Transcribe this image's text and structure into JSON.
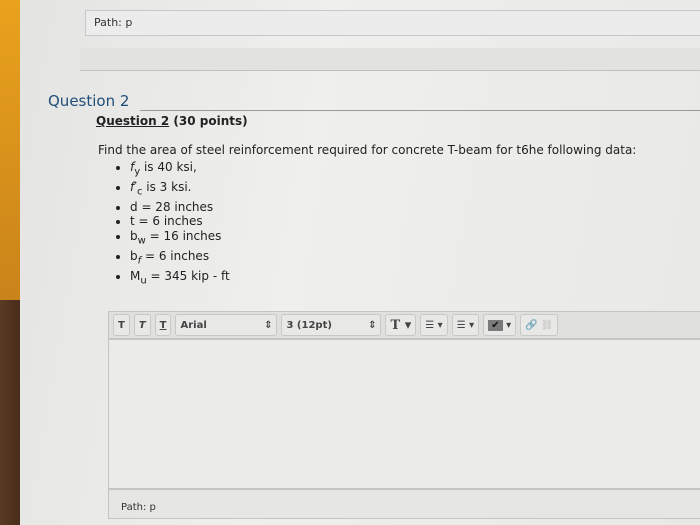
{
  "top_path": "Path: p",
  "question": {
    "heading": "Question 2",
    "sub_link": "Question 2",
    "points": "(30 points)",
    "prompt": "Find the area of steel reinforcement required for concrete T-beam for t6he following data:",
    "items": [
      {
        "sym": "f",
        "sub": "y",
        "text": " is 40 ksi,"
      },
      {
        "sym": "f′",
        "sub": "c",
        "text": " is 3 ksi."
      },
      {
        "sym": "d",
        "sub": "",
        "text": " = 28 inches"
      },
      {
        "sym": "t",
        "sub": "",
        "text": " = 6 inches"
      },
      {
        "sym": "b",
        "sub": "w",
        "text": " = 16 inches"
      },
      {
        "sym": "b",
        "sub": "f",
        "text": " = 6 inches"
      },
      {
        "sym": "M",
        "sub": "u",
        "text": " = 345 kip - ft"
      }
    ]
  },
  "toolbar": {
    "bold": "T",
    "italic": "T",
    "underline": "T",
    "font": "Arial",
    "size": "3 (12pt)",
    "text_color": "T",
    "bullets": "☰",
    "numbers": "☰",
    "spell": "✔",
    "link": "🔗",
    "unlink": "⛓"
  },
  "bottom_path": "Path: p"
}
